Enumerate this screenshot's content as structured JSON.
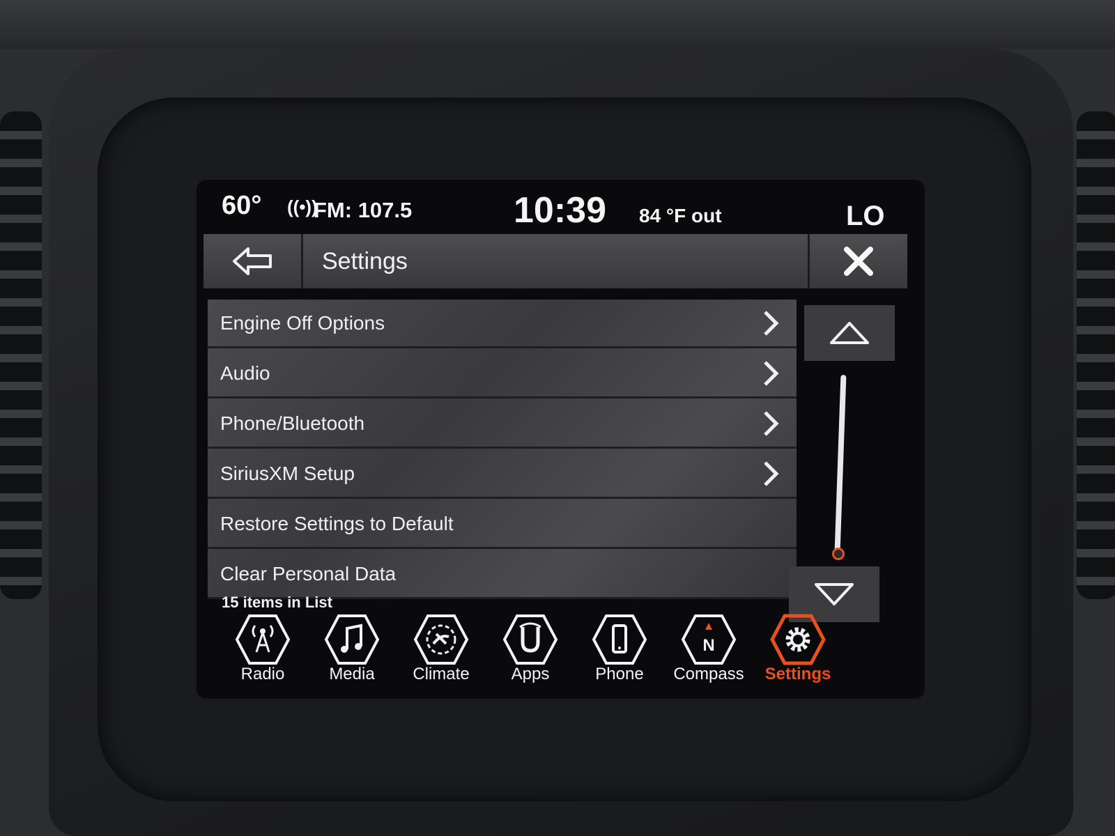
{
  "status": {
    "interior_temp": "60°",
    "radio_source": "FM: 107.5",
    "time": "10:39",
    "outside_temp": "84 °F out",
    "fan_level": "LO"
  },
  "header": {
    "title": "Settings",
    "back_icon": "back-arrow-icon",
    "close_icon": "close-icon"
  },
  "settings_list": {
    "items": [
      {
        "label": "Engine Off Options",
        "has_chevron": true
      },
      {
        "label": "Audio",
        "has_chevron": true
      },
      {
        "label": "Phone/Bluetooth",
        "has_chevron": true
      },
      {
        "label": "SiriusXM Setup",
        "has_chevron": true
      },
      {
        "label": "Restore Settings to Default",
        "has_chevron": false
      },
      {
        "label": "Clear Personal Data",
        "has_chevron": false
      }
    ],
    "count_text": "15 items in List"
  },
  "scroll": {
    "up_icon": "triangle-up-icon",
    "down_icon": "triangle-down-icon"
  },
  "dock": {
    "items": [
      {
        "label": "Radio",
        "icon": "radio-tower-icon"
      },
      {
        "label": "Media",
        "icon": "music-note-icon"
      },
      {
        "label": "Climate",
        "icon": "climate-icon"
      },
      {
        "label": "Apps",
        "icon": "apps-icon"
      },
      {
        "label": "Phone",
        "icon": "phone-icon"
      },
      {
        "label": "Compass",
        "icon": "compass-icon"
      },
      {
        "label": "Settings",
        "icon": "gear-icon",
        "active": true
      }
    ]
  },
  "colors": {
    "accent": "#e8501e",
    "text": "#f4f4f4",
    "panel": "#3c3c3f"
  }
}
